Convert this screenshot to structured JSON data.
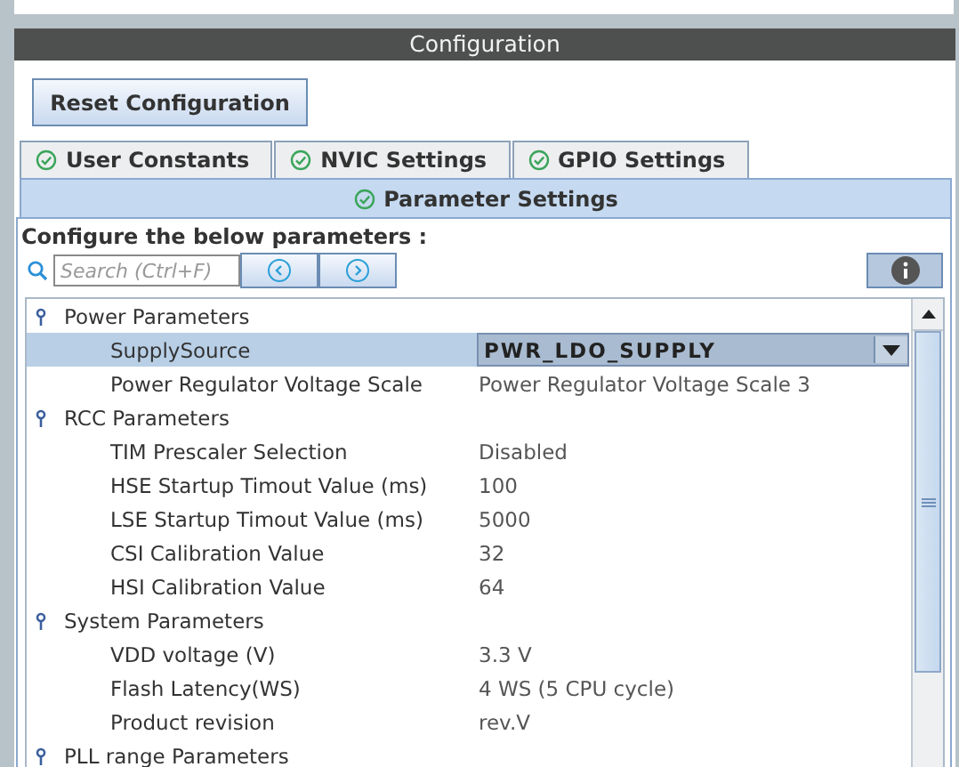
{
  "panel_title": "Configuration",
  "reset_button": "Reset Configuration",
  "tabs": [
    {
      "label": "User Constants",
      "selected": false
    },
    {
      "label": "NVIC Settings",
      "selected": false
    },
    {
      "label": "GPIO Settings",
      "selected": false
    },
    {
      "label": "Parameter Settings",
      "selected": true
    }
  ],
  "heading": "Configure the below parameters :",
  "search": {
    "placeholder": "Search (Ctrl+F)"
  },
  "groups": [
    {
      "name": "Power Parameters",
      "children": [
        {
          "name": "SupplySource",
          "value": "PWR_LDO_SUPPLY",
          "kind": "dropdown",
          "selected": true
        },
        {
          "name": "Power Regulator Voltage Scale",
          "value": "Power Regulator Voltage Scale 3",
          "kind": "text",
          "selected": false
        }
      ]
    },
    {
      "name": "RCC Parameters",
      "children": [
        {
          "name": "TIM Prescaler Selection",
          "value": "Disabled",
          "kind": "text",
          "selected": false
        },
        {
          "name": "HSE Startup Timout Value (ms)",
          "value": "100",
          "kind": "text",
          "selected": false
        },
        {
          "name": "LSE Startup Timout Value (ms)",
          "value": "5000",
          "kind": "text",
          "selected": false
        },
        {
          "name": "CSI Calibration Value",
          "value": "32",
          "kind": "text",
          "selected": false
        },
        {
          "name": "HSI Calibration Value",
          "value": "64",
          "kind": "text",
          "selected": false
        }
      ]
    },
    {
      "name": "System Parameters",
      "children": [
        {
          "name": "VDD voltage (V)",
          "value": "3.3 V",
          "kind": "text",
          "selected": false
        },
        {
          "name": "Flash Latency(WS)",
          "value": "4 WS (5 CPU cycle)",
          "kind": "text",
          "selected": false
        },
        {
          "name": "Product revision",
          "value": "rev.V",
          "kind": "text",
          "selected": false
        }
      ]
    },
    {
      "name": "PLL range Parameters"
    }
  ]
}
